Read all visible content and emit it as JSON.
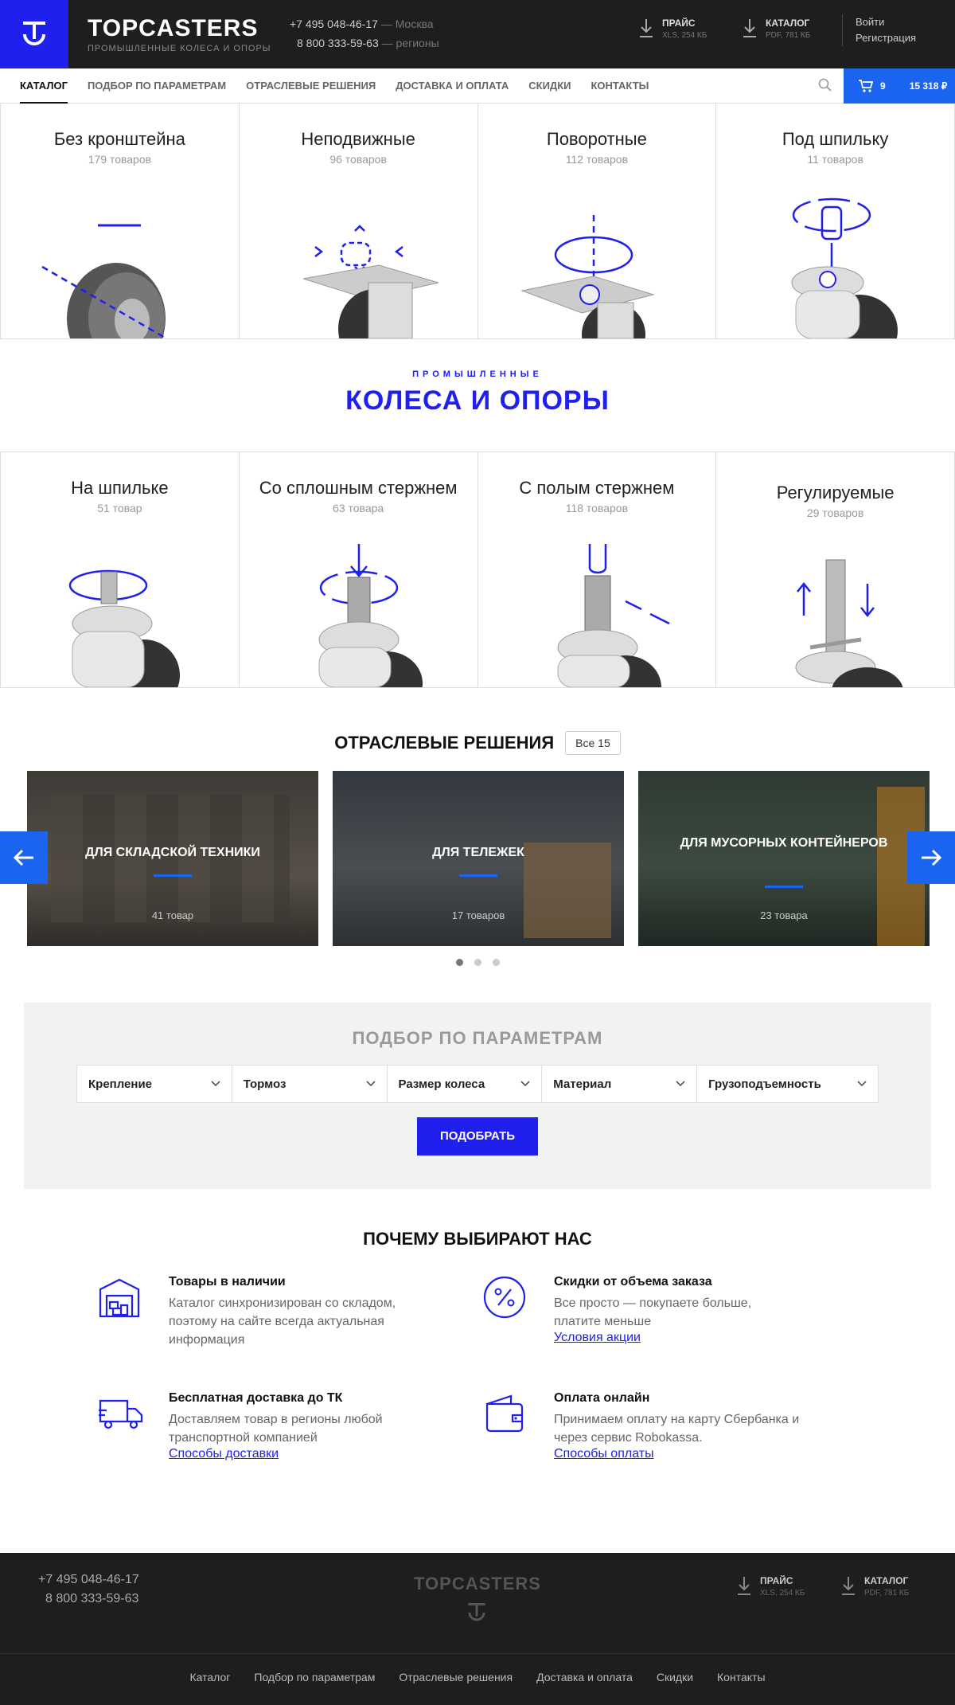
{
  "header": {
    "brand_name": "TOPCASTERS",
    "brand_sub": "ПРОМЫШЛЕННЫЕ КОЛЕСА И ОПОРЫ",
    "phone1": "+7 495 048-46-17",
    "phone1_region": "— Москва",
    "phone2": "8 800 333-59-63",
    "phone2_region": "— регионы",
    "price_title": "ПРАЙС",
    "price_sub": "XLS, 254 КБ",
    "catalog_title": "КАТАЛОГ",
    "catalog_sub": "PDF, 781 КБ",
    "login": "Войти",
    "register": "Регистрация"
  },
  "nav": {
    "items": [
      "КАТАЛОГ",
      "ПОДБОР ПО ПАРАМЕТРАМ",
      "ОТРАСЛЕВЫЕ РЕШЕНИЯ",
      "ДОСТАВКА И ОПЛАТА",
      "СКИДКИ",
      "КОНТАКТЫ"
    ],
    "cart_count": "9",
    "cart_total": "15 318 ₽"
  },
  "categories_top": [
    {
      "title": "Без кронштейна",
      "count": "179 товаров"
    },
    {
      "title": "Неподвижные",
      "count": "96 товаров"
    },
    {
      "title": "Поворотные",
      "count": "112 товаров"
    },
    {
      "title": "Под шпильку",
      "count": "11 товаров"
    }
  ],
  "hero": {
    "sub": "ПРОМЫШЛЕННЫЕ",
    "title": "КОЛЕСА И ОПОРЫ"
  },
  "categories_bottom": [
    {
      "title": "На шпильке",
      "count": "51 товар"
    },
    {
      "title": "Со сплошным стержнем",
      "count": "63 товара"
    },
    {
      "title": "С полым стержнем",
      "count": "118 товаров"
    },
    {
      "title": "Регулируемые",
      "count": "29 товаров"
    }
  ],
  "industry": {
    "title": "ОТРАСЛЕВЫЕ РЕШЕНИЯ",
    "all": "Все 15",
    "slides": [
      {
        "label": "ДЛЯ СКЛАДСКОЙ ТЕХНИКИ",
        "count": "41 товар"
      },
      {
        "label": "ДЛЯ ТЕЛЕЖЕК",
        "count": "17 товаров"
      },
      {
        "label": "ДЛЯ МУСОРНЫХ КОНТЕЙНЕРОВ",
        "count": "23 товара"
      }
    ]
  },
  "params": {
    "title": "ПОДБОР ПО ПАРАМЕТРАМ",
    "filters": [
      "Крепление",
      "Тормоз",
      "Размер колеса",
      "Материал",
      "Грузоподъемность"
    ],
    "button": "ПОДОБРАТЬ"
  },
  "why": {
    "title": "ПОЧЕМУ ВЫБИРАЮТ НАС",
    "features": [
      {
        "title": "Товары в наличии",
        "text": "Каталог синхронизирован со складом, поэтому на сайте всегда актуальная информация",
        "link": ""
      },
      {
        "title": "Скидки от объема заказа",
        "text": "Все просто — покупаете больше, платите меньше",
        "link": "Условия акции"
      },
      {
        "title": "Бесплатная доставка до ТК",
        "text": "Доставляем товар в регионы любой транспортной компанией",
        "link": "Способы доставки"
      },
      {
        "title": "Оплата онлайн",
        "text": "Принимаем оплату на карту Сбербанка и через сервис Robokassa.",
        "link": "Способы оплаты"
      }
    ]
  },
  "footer": {
    "phone1": "+7 495 048-46-17",
    "phone2": "8 800 333-59-63",
    "brand": "TOPCASTERS",
    "price_title": "ПРАЙС",
    "price_sub": "XLS, 254 КБ",
    "catalog_title": "КАТАЛОГ",
    "catalog_sub": "PDF, 781 КБ",
    "links": [
      "Каталог",
      "Подбор по параметрам",
      "Отраслевые решения",
      "Доставка и оплата",
      "Скидки",
      "Контакты"
    ]
  },
  "colors": {
    "accent": "#2020ee",
    "accent2": "#1a64f0",
    "dark": "#1e1e1e"
  }
}
